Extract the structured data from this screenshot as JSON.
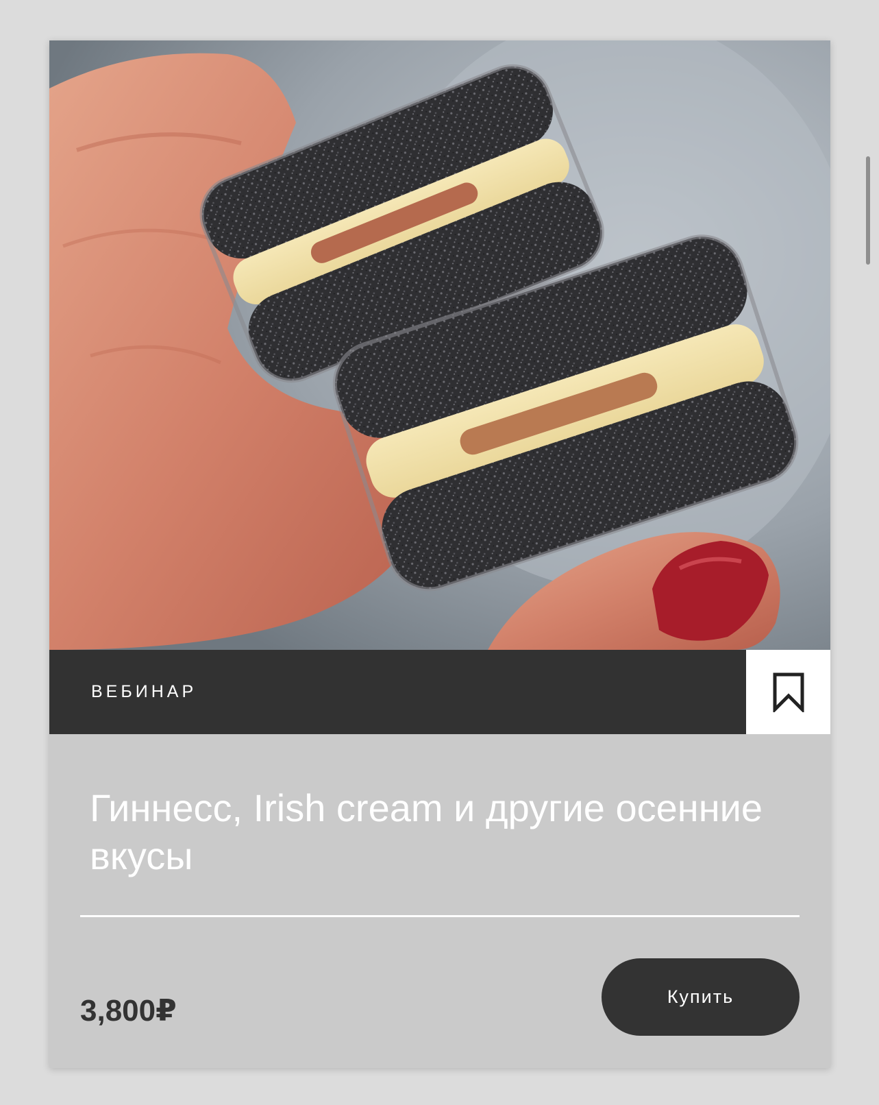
{
  "card": {
    "type_label": "ВЕБИНАР",
    "title": "Гиннесс, Irish cream и другие осенние вкусы",
    "price": "3,800₽",
    "buy_label": "Купить",
    "bookmark_icon": "bookmark-icon",
    "photo_subject": "black macarons with cream and caramel filling held in a hand"
  },
  "colors": {
    "bar": "#323232",
    "card_bg": "#cacaca",
    "button": "#333333",
    "text_light": "#ffffff"
  }
}
